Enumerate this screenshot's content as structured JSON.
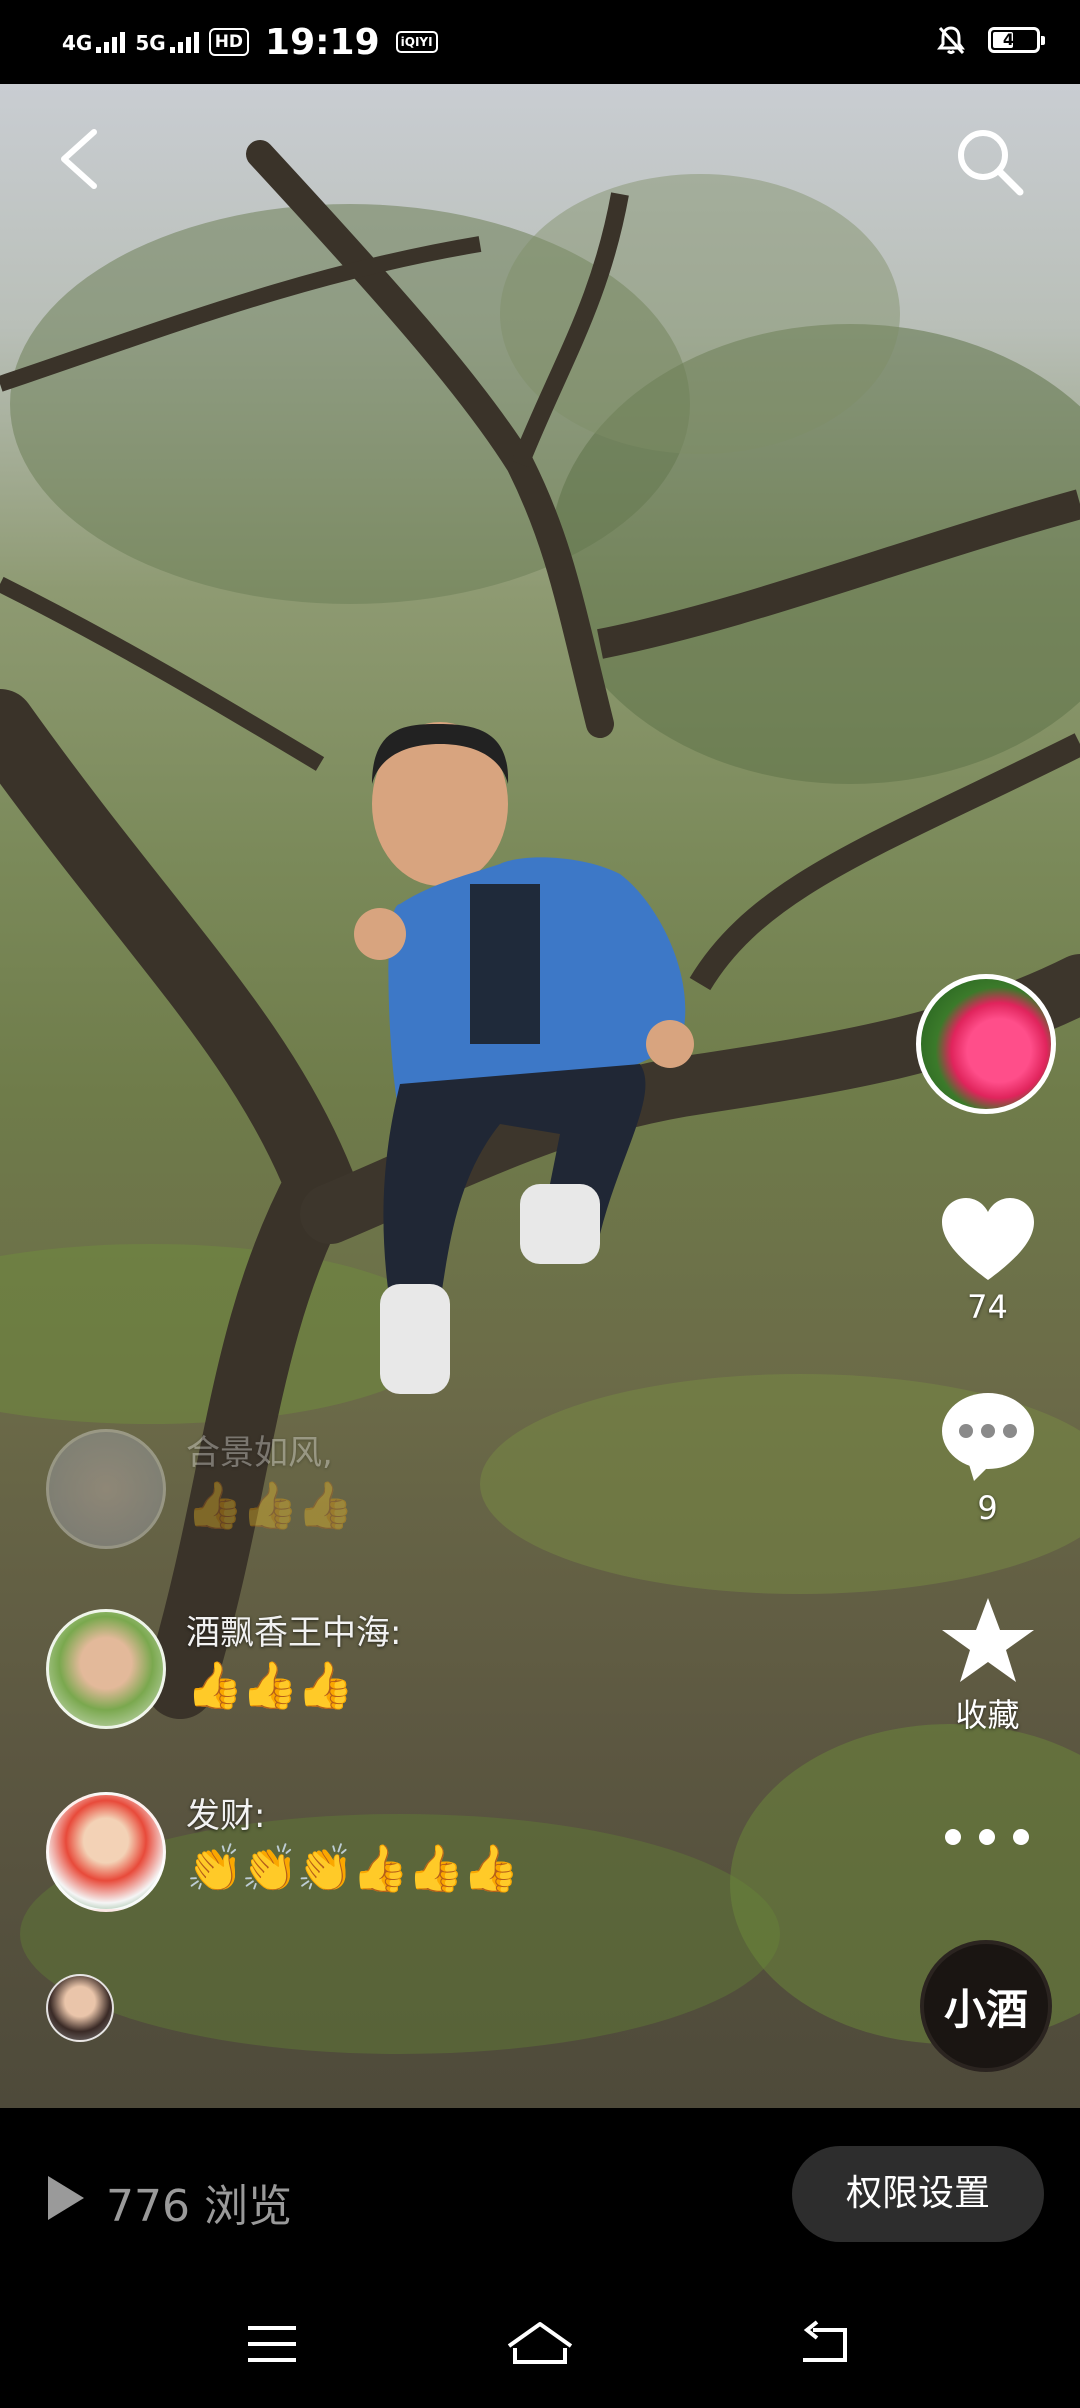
{
  "status_bar": {
    "network1": "4G",
    "network2": "5G",
    "hd": "HD",
    "time": "19:19",
    "app_badge": "iQIYI",
    "battery": "44"
  },
  "video": {
    "side_actions": {
      "like_count": "74",
      "comment_count": "9",
      "favorite_label": "收藏"
    },
    "music_label": "小酒",
    "comments": [
      {
        "name": "合景如风,",
        "text": "👍👍👍"
      },
      {
        "name": "酒飘香王中海:",
        "text": "👍👍👍"
      },
      {
        "name": "发财:",
        "text": "👏👏👏👍👍👍"
      }
    ]
  },
  "bottom_bar": {
    "view_count": "776",
    "view_label": "浏览",
    "permission_button": "权限设置"
  },
  "colors": {
    "button_bg": "#2d2d2d",
    "views_text": "#9a9a9a",
    "bar_bg": "#000000"
  },
  "icons": [
    "back-icon",
    "search-icon",
    "heart-icon",
    "comment-icon",
    "star-icon",
    "more-icon",
    "play-icon",
    "menu-icon",
    "home-icon",
    "return-icon",
    "mute-icon",
    "battery-icon"
  ]
}
